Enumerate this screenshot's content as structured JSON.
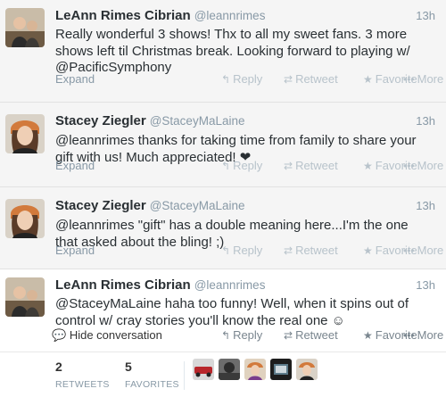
{
  "tweets": [
    {
      "name": "LeAnn Rimes Cibrian",
      "handle": "@leannrimes",
      "time": "13h",
      "text": "Really wonderful 3 shows! Thx to all my sweet fans. 3 more shows left til Christmas break. Looking forward to playing w/ @PacificSymphony",
      "expand": "Expand"
    },
    {
      "name": "Stacey Ziegler",
      "handle": "@StaceyMaLaine",
      "time": "13h",
      "text": "@leannrimes thanks for taking time from family to share your gift with us! Much appreciated! ❤",
      "expand": "Expand"
    },
    {
      "name": "Stacey Ziegler",
      "handle": "@StaceyMaLaine",
      "time": "13h",
      "text": "@leannrimes \"gift\" has a double meaning here...I'm the one that asked about the bling! ;)",
      "expand": "Expand"
    },
    {
      "name": "LeAnn Rimes Cibrian",
      "handle": "@leannrimes",
      "time": "13h",
      "text": "@StaceyMaLaine haha too funny! Well, when it spins out of control w/ cray stories you'll know the real one ☺",
      "hide_conversation": "Hide conversation"
    }
  ],
  "actions": {
    "reply": "Reply",
    "retweet": "Retweet",
    "favorite": "Favorite",
    "more": "More"
  },
  "stats": {
    "retweets_count": "2",
    "retweets_label": "RETWEETS",
    "favorites_count": "5",
    "favorites_label": "FAVORITES"
  }
}
